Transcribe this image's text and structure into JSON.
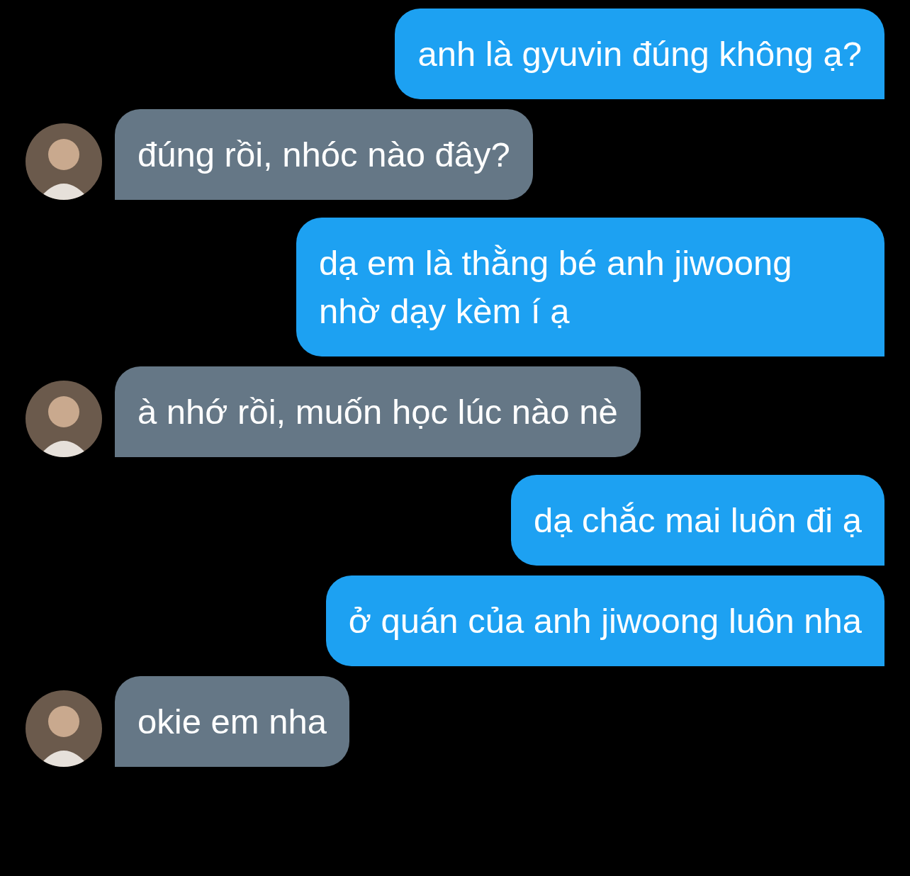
{
  "messages": [
    {
      "kind": "outgoing",
      "text": "anh là gyuvin đúng không ạ?"
    },
    {
      "kind": "incoming",
      "text": "đúng rồi, nhóc nào đây?"
    },
    {
      "kind": "outgoing",
      "text": "dạ em là thằng bé anh jiwoong nhờ dạy kèm í ạ"
    },
    {
      "kind": "incoming",
      "text": "à nhớ rồi, muốn học lúc nào nè"
    },
    {
      "kind": "outgoing",
      "text": "dạ chắc mai luôn đi ạ"
    },
    {
      "kind": "outgoing",
      "text": "ở quán của anh jiwoong luôn nha"
    },
    {
      "kind": "incoming",
      "text": "okie em nha"
    }
  ]
}
